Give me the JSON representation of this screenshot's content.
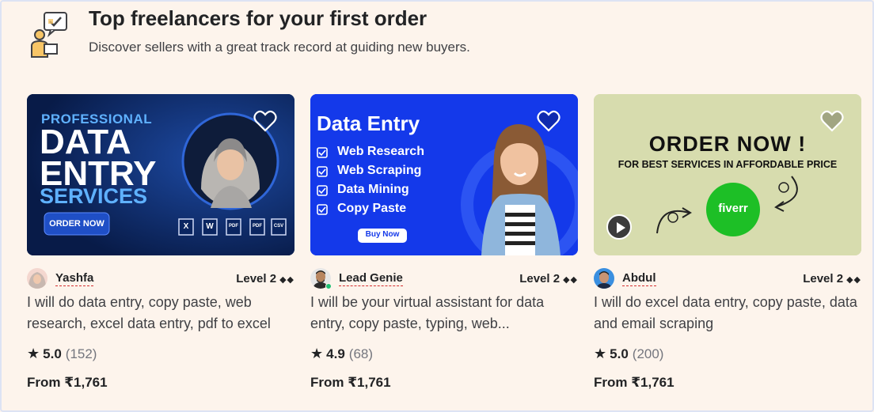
{
  "header": {
    "title": "Top freelancers for your first order",
    "subtitle": "Discover sellers with a great track record at guiding new buyers."
  },
  "cards": [
    {
      "image": {
        "line1": "PROFESSIONAL",
        "line2": "DATA",
        "line3": "ENTRY",
        "line4": "SERVICES",
        "button": "ORDER NOW",
        "apps": [
          "X",
          "W",
          "PDF",
          "PDF",
          "CSV"
        ]
      },
      "seller": "Yashfa",
      "level": "Level 2",
      "diamonds": "◆◆",
      "title": "I will do data entry, copy paste, web research, excel data entry, pdf to excel",
      "rating": "5.0",
      "reviews": "(152)",
      "price": "From ₹1,761",
      "colors": {
        "bg": "#0a2560"
      }
    },
    {
      "image": {
        "heading": "Data Entry",
        "items": [
          "Web Research",
          "Web Scraping",
          "Data Mining",
          "Copy Paste"
        ],
        "button": "Buy Now"
      },
      "seller": "Lead Genie",
      "level": "Level 2",
      "diamonds": "◆◆",
      "title": "I will be your virtual assistant for data entry, copy paste, typing, web...",
      "rating": "4.9",
      "reviews": "(68)",
      "price": "From ₹1,761",
      "online": true,
      "colors": {
        "bg": "#1439ea"
      }
    },
    {
      "image": {
        "heading": "ORDER NOW !",
        "sub": "FOR BEST SERVICES IN AFFORDABLE PRICE",
        "logo": "fiverr"
      },
      "seller": "Abdul",
      "level": "Level 2",
      "diamonds": "◆◆",
      "title": "I will do excel data entry, copy paste, data and email scraping",
      "rating": "5.0",
      "reviews": "(200)",
      "price": "From ₹1,761",
      "colors": {
        "bg": "#d7dcae",
        "logo": "#1dbf26"
      }
    }
  ]
}
